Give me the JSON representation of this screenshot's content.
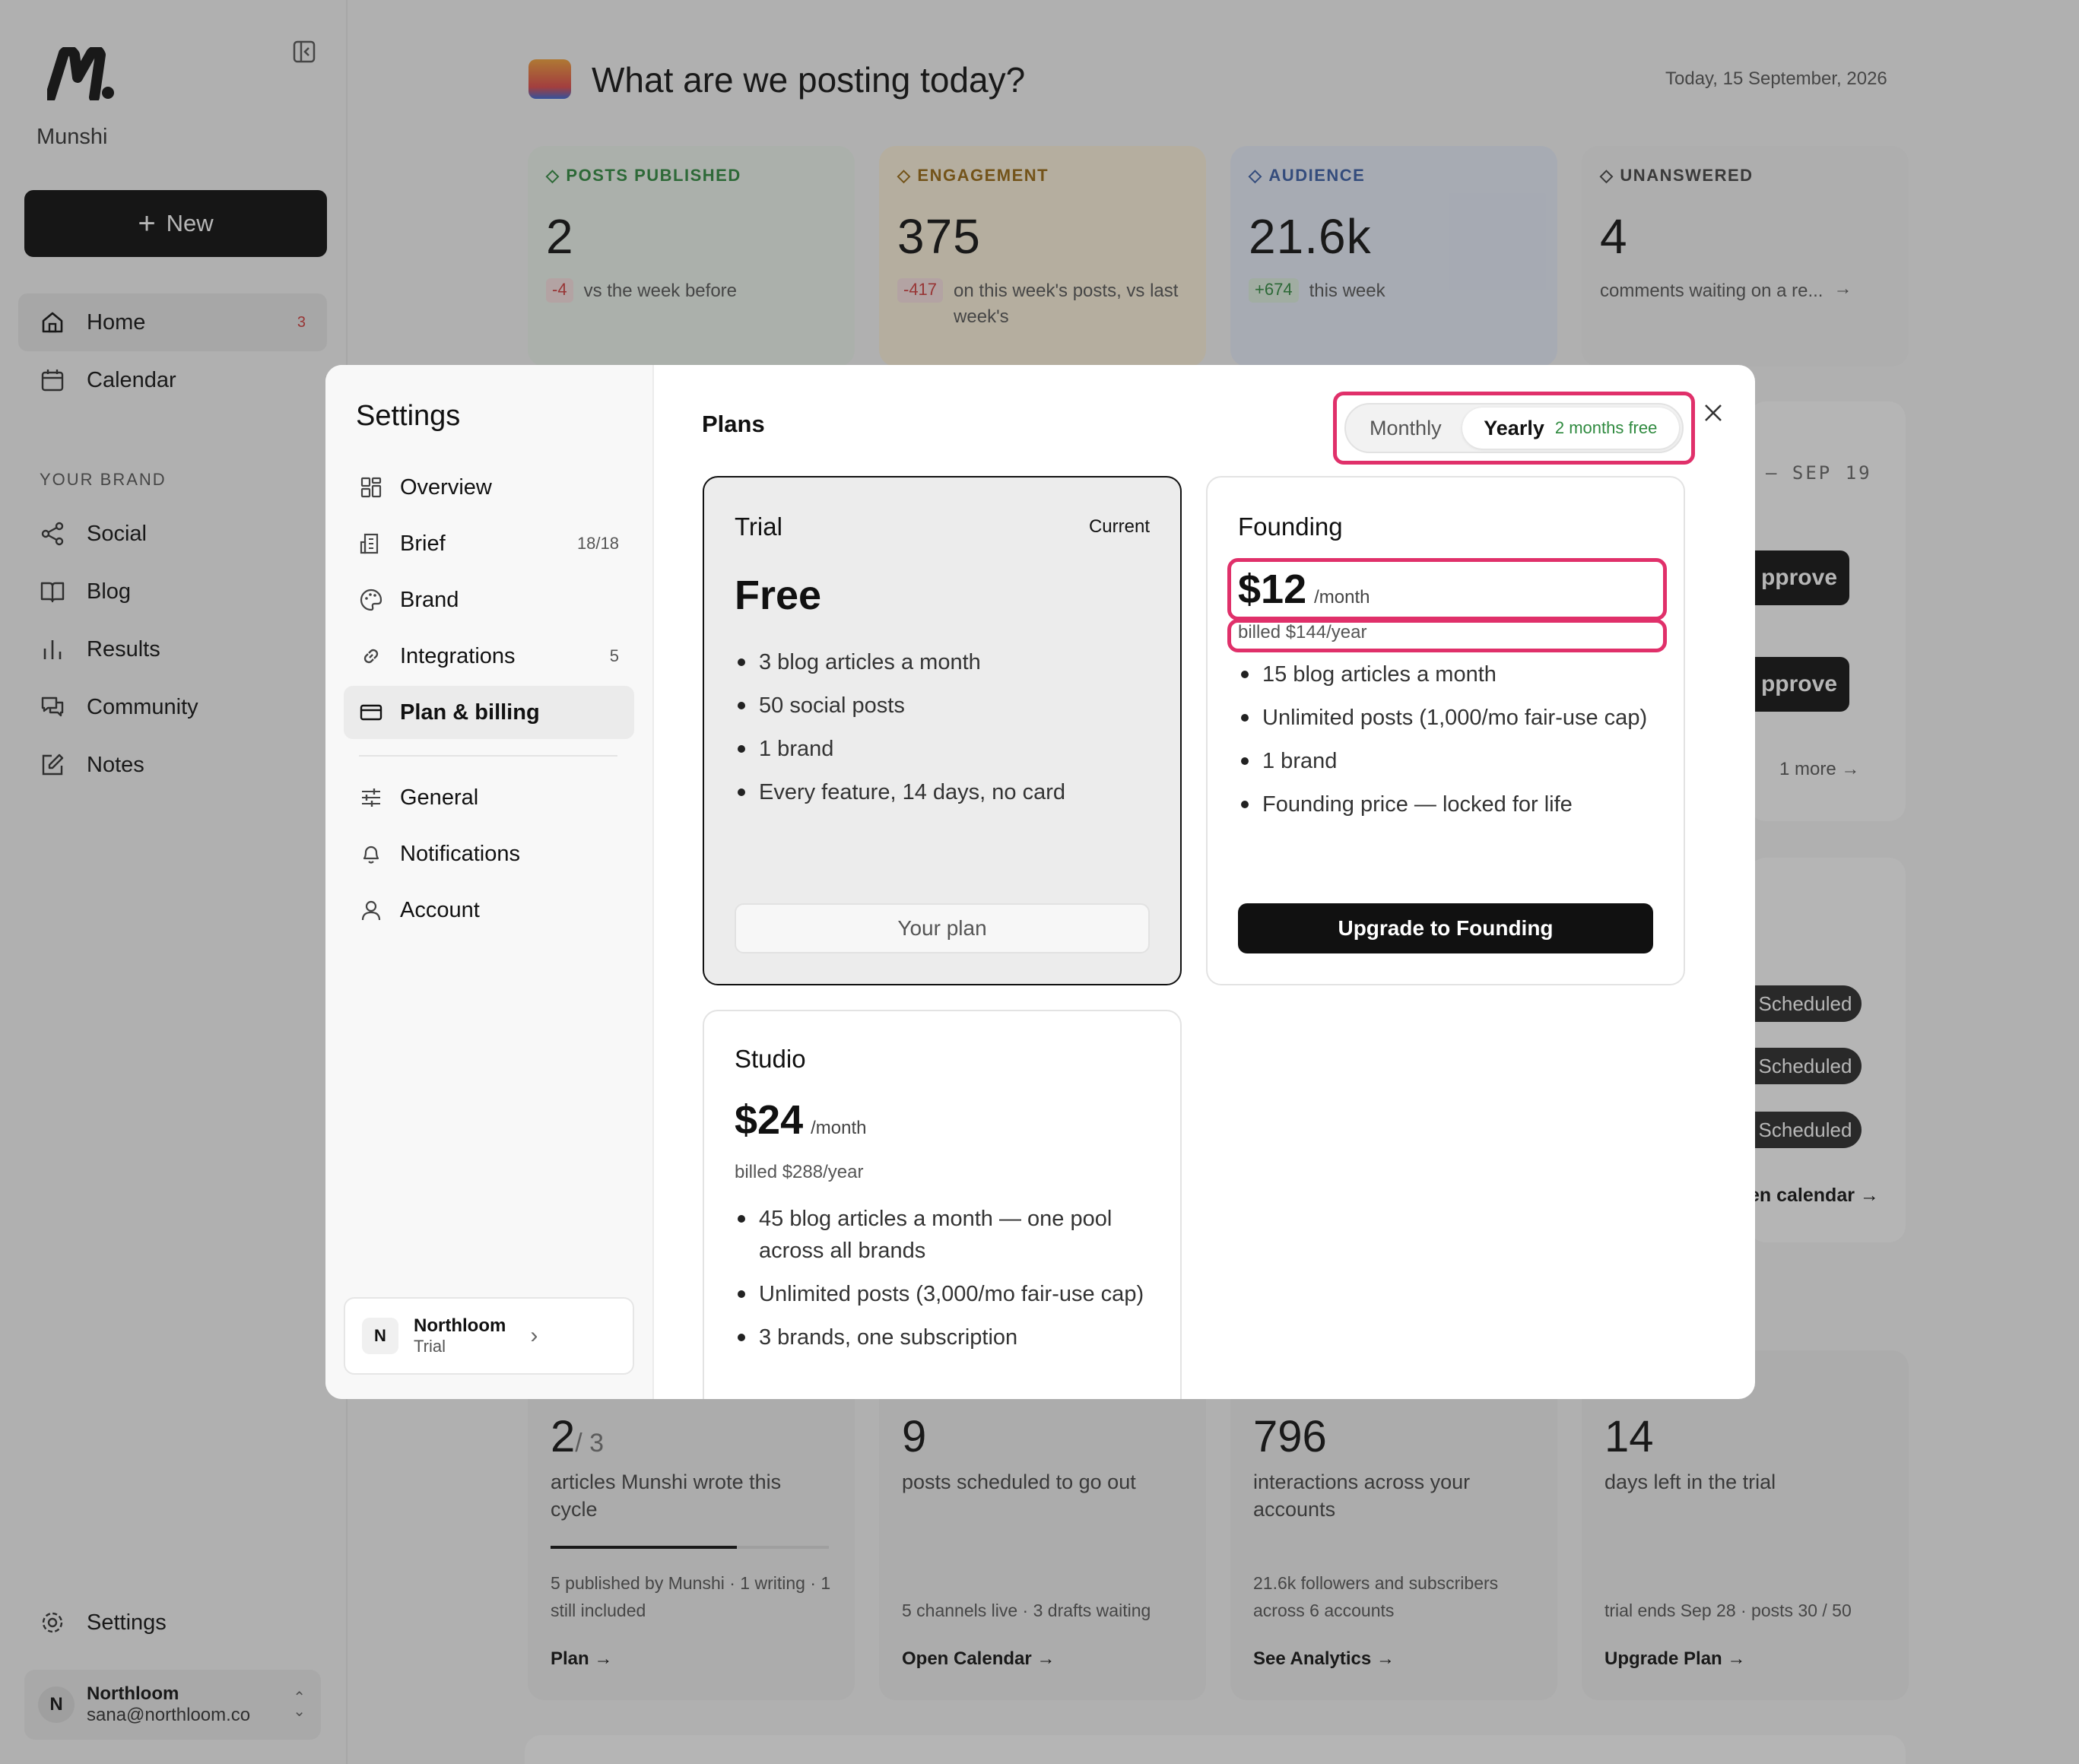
{
  "app": {
    "brand": "Munshi",
    "new_label": "New"
  },
  "nav": {
    "primary": [
      {
        "label": "Home",
        "count": "3"
      },
      {
        "label": "Calendar"
      }
    ],
    "section_label": "YOUR BRAND",
    "brand": [
      {
        "label": "Social"
      },
      {
        "label": "Blog"
      },
      {
        "label": "Results"
      },
      {
        "label": "Community"
      },
      {
        "label": "Notes"
      }
    ],
    "settings_label": "Settings"
  },
  "user": {
    "initial": "N",
    "name": "Northloom",
    "email": "sana@northloom.co"
  },
  "header": {
    "greeting": "What are we posting today?",
    "date": "Today, 15 September, 2026"
  },
  "stats": [
    {
      "label": "POSTS PUBLISHED",
      "value": "2",
      "delta": "-4",
      "note": "vs the week before",
      "color": "#2f8a3f",
      "bg": "#eef6ee",
      "delta_color": "#d23c3c",
      "delta_bg": "#fbe3e3"
    },
    {
      "label": "ENGAGEMENT",
      "value": "375",
      "delta": "-417",
      "note": "on this week's posts, vs last week's",
      "color": "#9a6a12",
      "bg": "#fdf3dc",
      "delta_color": "#d23c3c",
      "delta_bg": "#fbe3e3"
    },
    {
      "label": "AUDIENCE",
      "value": "21.6k",
      "delta": "+674",
      "note": "this week",
      "color": "#3a5ea8",
      "bg": "#e8eefb",
      "delta_color": "#2f8a3f",
      "delta_bg": "#dff2e1"
    },
    {
      "label": "UNANSWERED",
      "value": "4",
      "delta": "",
      "note": "comments waiting on a re...",
      "color": "#444",
      "bg": "#f3f3f3",
      "delta_color": "",
      "delta_bg": ""
    }
  ],
  "right_panel": {
    "date_range": "– SEP 19",
    "approve_label": "pprove",
    "more": "1 more",
    "scheduled_label": "Scheduled",
    "calendar_link": "en calendar →"
  },
  "bottom_cards": [
    {
      "big": "2",
      "big_suffix": "/ 3",
      "desc": "articles Munshi wrote this cycle",
      "progress": 0.67,
      "foot": "5 published by Munshi · 1 writing · 1 still included",
      "link": "Plan →"
    },
    {
      "big": "9",
      "big_suffix": "",
      "desc": "posts scheduled to go out",
      "foot": "5 channels live · 3 drafts waiting",
      "link": "Open Calendar →"
    },
    {
      "big": "796",
      "big_suffix": "",
      "desc": "interactions across your accounts",
      "foot": "21.6k followers and subscribers across 6 accounts",
      "link": "See Analytics →"
    },
    {
      "big": "14",
      "big_suffix": "",
      "desc": "days left in the trial",
      "foot": "trial ends Sep 28 · posts 30 / 50",
      "link": "Upgrade Plan →"
    }
  ],
  "settings": {
    "title": "Settings",
    "menu": [
      {
        "label": "Overview",
        "count": ""
      },
      {
        "label": "Brief",
        "count": "18/18"
      },
      {
        "label": "Brand",
        "count": ""
      },
      {
        "label": "Integrations",
        "count": "5"
      },
      {
        "label": "Plan & billing",
        "count": ""
      }
    ],
    "menu2": [
      {
        "label": "General"
      },
      {
        "label": "Notifications"
      },
      {
        "label": "Account"
      }
    ],
    "workspace": {
      "initial": "N",
      "name": "Northloom",
      "plan": "Trial"
    },
    "plans_title": "Plans",
    "toggle": {
      "monthly": "Monthly",
      "yearly": "Yearly",
      "yearly_badge": "2 months free",
      "selected": "yearly"
    },
    "plans": [
      {
        "name": "Trial",
        "tag": "Current",
        "price": "Free",
        "per": "",
        "billed": "",
        "features": [
          "3 blog articles a month",
          "50 social posts",
          "1 brand",
          "Every feature, 14 days, no card"
        ],
        "cta": "Your plan"
      },
      {
        "name": "Founding",
        "tag": "",
        "price": "$12",
        "per": "/month",
        "billed": "billed $144/year",
        "features": [
          "15 blog articles a month",
          "Unlimited posts (1,000/mo fair-use cap)",
          "1 brand",
          "Founding price — locked for life"
        ],
        "cta": "Upgrade to Founding"
      },
      {
        "name": "Studio",
        "tag": "",
        "price": "$24",
        "per": "/month",
        "billed": "billed $288/year",
        "features": [
          "45 blog articles a month — one pool across all brands",
          "Unlimited posts (3,000/mo fair-use cap)",
          "3 brands, one subscription"
        ],
        "cta": ""
      }
    ]
  }
}
